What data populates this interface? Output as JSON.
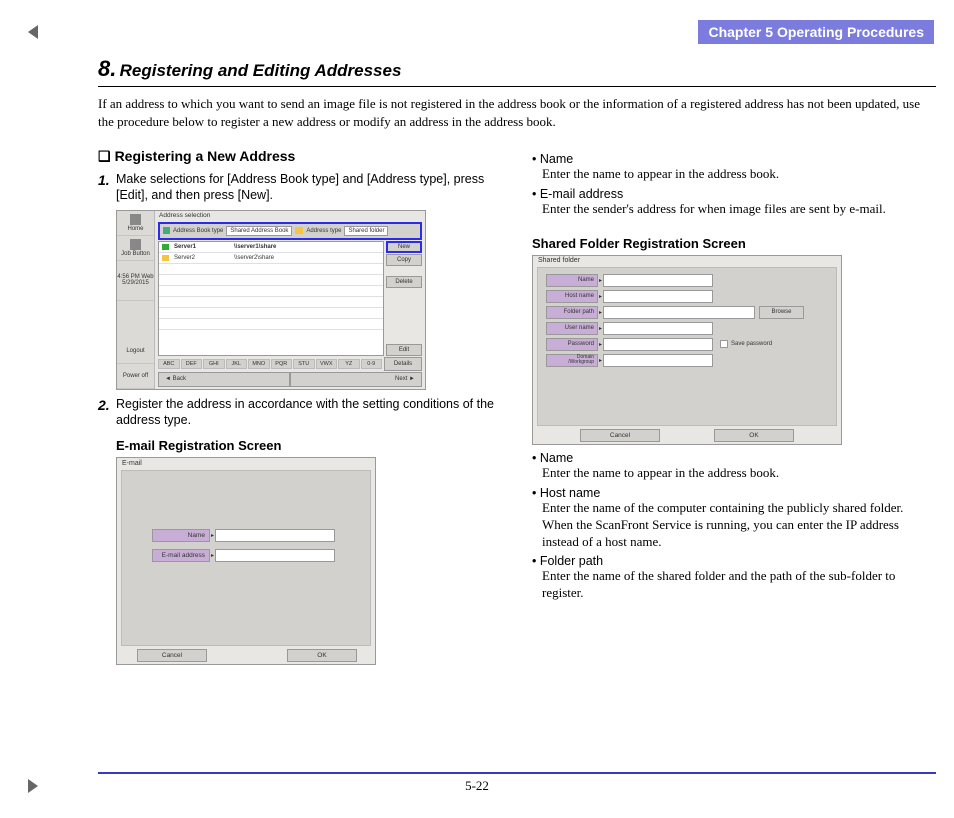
{
  "chapter": {
    "label": "Chapter 5   Operating Procedures"
  },
  "section": {
    "number": "8.",
    "title": "Registering and Editing Addresses"
  },
  "intro": "If an address to which you want to send an image file is not registered in the address book or the information of a registered address has not been updated, use the procedure below to register a new address or modify an address in the address book.",
  "left": {
    "marker": "❏",
    "heading": "Registering a New Address",
    "step1_num": "1.",
    "step1_text": "Make selections for [Address Book type] and [Address type], press [Edit], and then press [New].",
    "step2_num": "2.",
    "step2_text": "Register the address in accordance with the setting conditions of the address type.",
    "email_caption": "E-mail Registration Screen"
  },
  "right": {
    "bullets_top": [
      {
        "term": "• Name",
        "body": "Enter the name to appear in the address book."
      },
      {
        "term": "• E-mail address",
        "body": "Enter the sender's address for when image files are sent by e-mail."
      }
    ],
    "shared_caption": "Shared Folder Registration Screen",
    "bullets_bottom": [
      {
        "term": "• Name",
        "body": "Enter the name to appear in the address book."
      },
      {
        "term": "• Host name",
        "body": "Enter the name of the computer containing the publicly shared folder. When the ScanFront Service is running, you can enter the IP address instead of a host name."
      },
      {
        "term": "• Folder path",
        "body": "Enter the name of the shared folder and the path of the sub-folder to register."
      }
    ]
  },
  "shot1": {
    "title": "Address selection",
    "sidebar": {
      "home": "Home",
      "job": "Job Button",
      "time": "4:56 PM  Web\n5/29/2015",
      "logout": "Logout",
      "poweroff": "Power off"
    },
    "toolbar": {
      "abtype_label": "Address Book type",
      "abtype_value": "Shared Address Book",
      "atype_label": "Address type",
      "atype_value": "Shared folder"
    },
    "rows": [
      {
        "name": "Server1",
        "path": "\\\\server1\\share"
      },
      {
        "name": "Server2",
        "path": "\\\\server2\\share"
      }
    ],
    "buttons": {
      "new": "New",
      "copy": "Copy",
      "delete": "Delete",
      "edit": "Edit",
      "details": "Details"
    },
    "letters": [
      "ABC",
      "DEF",
      "GHI",
      "JKL",
      "MNO",
      "PQR",
      "STU",
      "VWX",
      "YZ",
      "0-9"
    ],
    "nav": {
      "back": "◄     Back",
      "next": "Next     ►"
    }
  },
  "shot2": {
    "title": "E-mail",
    "fields": {
      "name": "Name",
      "email": "E-mail address"
    },
    "buttons": {
      "cancel": "Cancel",
      "ok": "OK"
    }
  },
  "shot3": {
    "title": "Shared folder",
    "fields": {
      "name": "Name",
      "host": "Host name",
      "folder": "Folder path",
      "user": "User name",
      "pass": "Password",
      "domain": "Domain\n/Workgroup"
    },
    "browse": "Browse",
    "savepw": "Save password",
    "buttons": {
      "cancel": "Cancel",
      "ok": "OK"
    }
  },
  "page_number": "5-22"
}
